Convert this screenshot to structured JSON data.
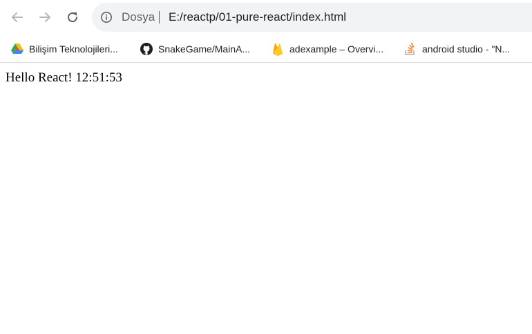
{
  "toolbar": {
    "back_icon": "arrow-left-icon",
    "forward_icon": "arrow-right-icon",
    "reload_icon": "reload-icon"
  },
  "omnibox": {
    "info_icon": "info-icon",
    "scheme_label": "Dosya",
    "url": "E:/reactp/01-pure-react/index.html"
  },
  "bookmarks": [
    {
      "icon": "google-drive-icon",
      "label": "Bilişim Teknolojileri..."
    },
    {
      "icon": "github-icon",
      "label": "SnakeGame/MainA..."
    },
    {
      "icon": "firebase-icon",
      "label": "adexample – Overvi..."
    },
    {
      "icon": "stackoverflow-icon",
      "label": "android studio - \"N..."
    }
  ],
  "page": {
    "text": "Hello React! 12:51:53"
  }
}
